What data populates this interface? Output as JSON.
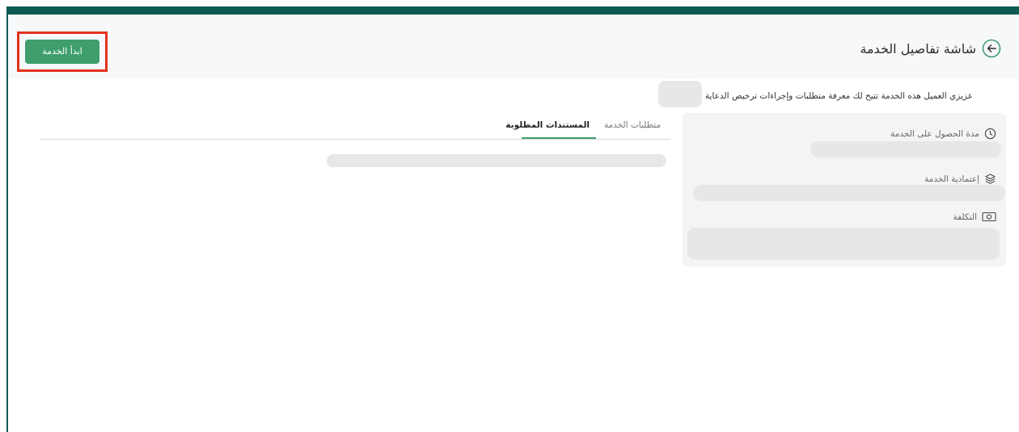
{
  "header": {
    "title": "شاشة تفاصيل الخدمة",
    "start_button": "ابدأ الخدمة"
  },
  "intro": {
    "text": "عزيزي العميل هذه الخدمة تتيح لك معرفة متطلبات وإجراءات ترخيص الدعاية والإعلان ا"
  },
  "info": {
    "duration_label": "مدة الحصول على الخدمة",
    "approval_label": "إعتمادية الخدمة",
    "cost_label": "التكلفة"
  },
  "tabs": [
    {
      "label": "متطلبات الخدمة",
      "active": false
    },
    {
      "label": "المستندات المطلوبة",
      "active": true
    }
  ],
  "colors": {
    "brand_dark": "#0b5b52",
    "primary_button": "#3f9e6c",
    "highlight_box": "#e5321c",
    "skeleton": "#e7e7e7"
  }
}
